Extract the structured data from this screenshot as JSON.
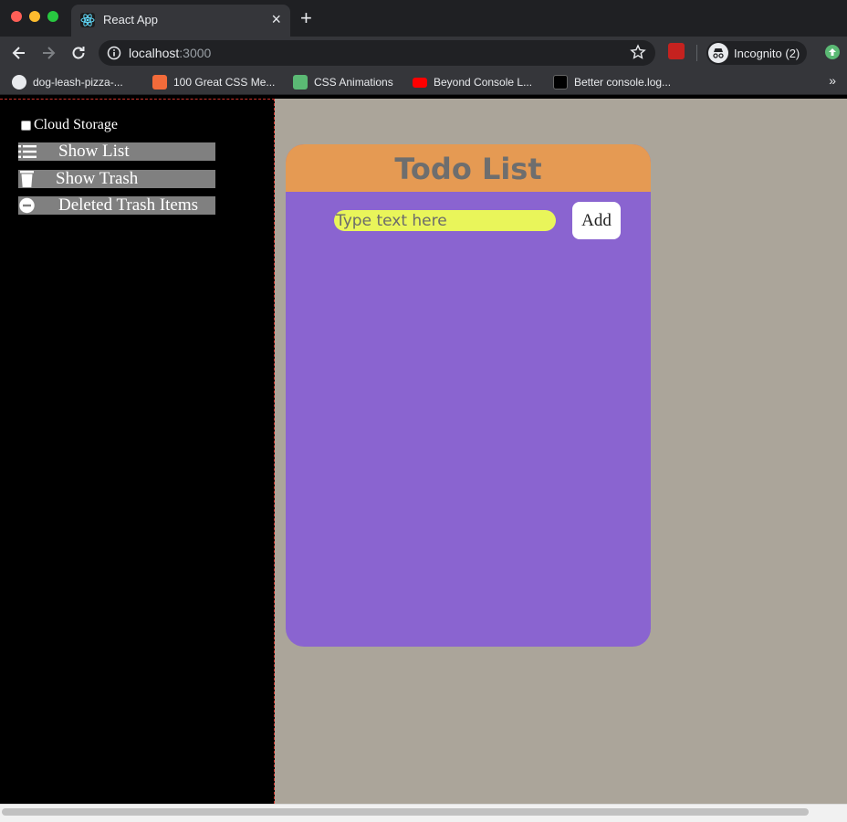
{
  "browser": {
    "tab": {
      "title": "React App",
      "favicon": "react-logo-icon"
    },
    "url": {
      "host": "localhost",
      "port": ":3000"
    },
    "profile": {
      "label": "Incognito (2)"
    },
    "bookmarks": [
      {
        "label": "dog-leash-pizza-...",
        "icon": "globe-icon",
        "color": "#e8eaed"
      },
      {
        "label": "100 Great CSS Me...",
        "icon": "css-icon",
        "color": "#f26b3a"
      },
      {
        "label": "CSS Animations",
        "icon": "animation-icon",
        "color": "#5bb974"
      },
      {
        "label": "Beyond Console L...",
        "icon": "youtube-icon",
        "color": "#ff0000"
      },
      {
        "label": "Better console.log...",
        "icon": "dev-icon",
        "color": "#000000"
      }
    ],
    "bookmarks_more": "»"
  },
  "sidebar": {
    "cloud_storage_label": "Cloud Storage",
    "buttons": {
      "show_list": "Show List",
      "show_trash": "Show Trash",
      "deleted_trash": "Deleted Trash Items"
    }
  },
  "todo": {
    "title": "Todo List",
    "input_placeholder": "Type text here",
    "add_label": "Add"
  },
  "colors": {
    "page_bg": "#aba59a",
    "card_body": "#8a64d0",
    "card_header": "#e59a53",
    "input_bg": "#e9f55a",
    "sidebar_button": "#808080"
  }
}
